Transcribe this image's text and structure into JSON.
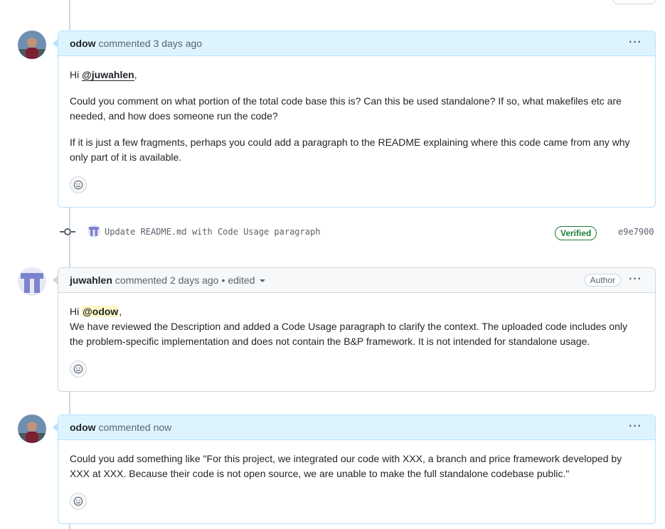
{
  "comments": [
    {
      "author": "odow",
      "meta": "commented 3 days ago",
      "greeting_prefix": "Hi ",
      "mention": "@juwahlen",
      "greeting_suffix": ",",
      "paragraph1": "Could you comment on what portion of the total code base this is? Can this be used standalone? If so, what makefiles etc are needed, and how does someone run the code?",
      "paragraph2": "If it is just a few fragments, perhaps you could add a paragraph to the README explaining where this code came from any why only part of it is available."
    },
    {
      "author": "juwahlen",
      "meta": "commented 2 days ago",
      "edited": "edited",
      "badge": "Author",
      "greeting_prefix": "Hi ",
      "mention": "@odow",
      "greeting_suffix": ",",
      "paragraph1": "We have reviewed the Description and added a Code Usage paragraph to clarify the context. The uploaded code includes only the problem-specific implementation and does not contain the B&P framework. It is not intended for standalone usage."
    },
    {
      "author": "odow",
      "meta": "commented now",
      "paragraph1": "Could you add something like \"For this project, we integrated our code with XXX, a branch and price framework developed by XXX at XXX. Because their code is not open source, we are unable to make the full standalone codebase public.\""
    }
  ],
  "commit": {
    "message": "Update README.md with Code Usage paragraph",
    "verified": "Verified",
    "sha": "e9e7900"
  },
  "kebab": "···",
  "dot": "•",
  "icons": {
    "menu": "kebab-icon",
    "reaction": "smiley-icon",
    "commit": "git-commit-icon",
    "dropdown": "triangle-down-icon"
  },
  "colors": {
    "own_header": "#ddf4ff",
    "own_border": "#b6e3ff",
    "verified": "#1a7f37",
    "mention_highlight": "#fff8c5"
  }
}
